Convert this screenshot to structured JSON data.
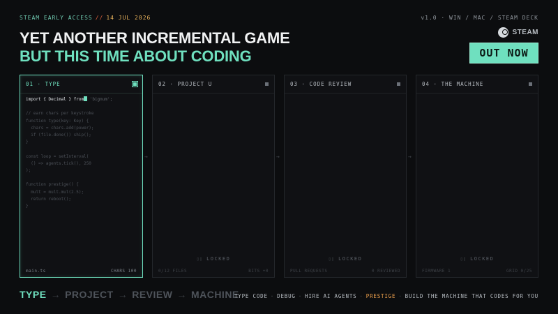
{
  "topbar": {
    "early_access": "STEAM EARLY ACCESS",
    "separator": "//",
    "date": "14 JUL 2026",
    "platforms": "v1.0 · WIN / MAC / STEAM DECK"
  },
  "headline": {
    "line1": "YET ANOTHER INCREMENTAL GAME",
    "line2": "BUT THIS TIME ABOUT CODING"
  },
  "store": {
    "label": "STEAM",
    "icon": "steam-icon",
    "cta": "OUT NOW"
  },
  "panels": [
    {
      "title": "01 · TYPE",
      "code": {
        "import_kw": "import { Decimal } from",
        "import_str": "'bignum';",
        "lines": [
          "// earn chars per keystroke",
          "function type(key: Key) {",
          "  chars = chars.add(power);",
          "  if (file.done()) ship();",
          "}",
          "",
          "const loop = setInterval(",
          "  () => agents.tick(), 250",
          ");",
          "",
          "function prestige() {",
          "  mult = mult.mul(2.5);",
          "  return reboot();",
          "}"
        ]
      },
      "footer_left": "main.ts",
      "footer_right": "CHARS 100"
    },
    {
      "title": "02 · PROJECT U",
      "locked": "LOCKED",
      "footer_left": "0/12 FILES",
      "footer_right": "BITS +0"
    },
    {
      "title": "03 · CODE REVIEW",
      "locked": "LOCKED",
      "footer_left": "PULL REQUESTS",
      "footer_right": "0 REVIEWED"
    },
    {
      "title": "04 · THE MACHINE",
      "locked": "LOCKED",
      "footer_left": "FIRMWARE 1",
      "footer_right": "GRID 0/25"
    }
  ],
  "lock_glyph": "▯▯",
  "flow_arrow": "→",
  "steps": [
    "TYPE",
    "PROJECT",
    "REVIEW",
    "MACHINE"
  ],
  "tagline": {
    "items": [
      "TYPE CODE",
      "DEBUG",
      "HIRE AI AGENTS",
      "PRESTIGE",
      "BUILD THE MACHINE THAT CODES FOR YOU"
    ],
    "bullet": "·"
  },
  "colors": {
    "accent": "#6fe0bf",
    "warn": "#f0a24d",
    "date": "#e8b25c",
    "bg": "#0c0d0f"
  }
}
